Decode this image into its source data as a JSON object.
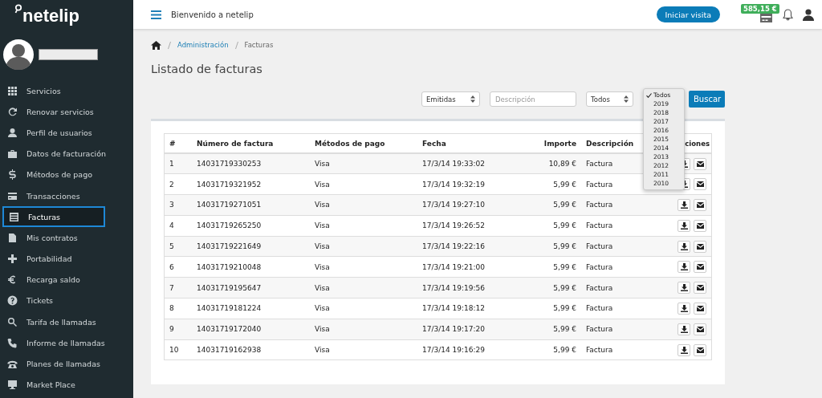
{
  "brand": "netelip",
  "sidebar": {
    "items": [
      {
        "label": "Servicios",
        "selected": false
      },
      {
        "label": "Renovar servicios",
        "selected": false
      },
      {
        "label": "Perfil de usuarios",
        "selected": false
      },
      {
        "label": "Datos de facturación",
        "selected": false
      },
      {
        "label": "Métodos de pago",
        "selected": false
      },
      {
        "label": "Transacciones",
        "selected": false
      },
      {
        "label": "Facturas",
        "selected": true
      },
      {
        "label": "Mis contratos",
        "selected": false
      },
      {
        "label": "Portabilidad",
        "selected": false
      },
      {
        "label": "Recarga saldo",
        "selected": false
      },
      {
        "label": "Tickets",
        "selected": false
      },
      {
        "label": "Tarifa de llamadas",
        "selected": false
      },
      {
        "label": "Informe de llamadas",
        "selected": false
      },
      {
        "label": "Planes de llamadas",
        "selected": false
      },
      {
        "label": "Market Place",
        "selected": false
      }
    ]
  },
  "topbar": {
    "title": "Bienvenido a netelip",
    "button": "Iniciar visita",
    "balance": "585,15 €"
  },
  "breadcrumb": [
    "Administración",
    "Facturas"
  ],
  "page_title": "Listado de facturas",
  "filters": {
    "type": "Emitidas",
    "description_placeholder": "Descripción",
    "year": "Todos",
    "button": "Buscar",
    "options": [
      {
        "label": "Todos",
        "selected": true
      },
      {
        "label": "2019",
        "selected": false
      },
      {
        "label": "2018",
        "selected": false
      },
      {
        "label": "2017",
        "selected": false
      },
      {
        "label": "2016",
        "selected": false
      },
      {
        "label": "2015",
        "selected": false
      },
      {
        "label": "2014",
        "selected": false
      },
      {
        "label": "2013",
        "selected": false
      },
      {
        "label": "2012",
        "selected": false
      },
      {
        "label": "2011",
        "selected": false
      },
      {
        "label": "2010",
        "selected": false
      }
    ]
  },
  "table": {
    "columns": [
      "#",
      "Número de factura",
      "Métodos de pago",
      "Fecha",
      "Importe",
      "Descripción",
      "ciones"
    ],
    "rows": [
      [
        "1",
        "14031719330253",
        "Visa",
        "17/3/14 19:33:02",
        "10,89 €",
        "Factura"
      ],
      [
        "2",
        "14031719321952",
        "Visa",
        "17/3/14 19:32:19",
        "5,99 €",
        "Factura"
      ],
      [
        "3",
        "14031719271051",
        "Visa",
        "17/3/14 19:27:10",
        "5,99 €",
        "Factura"
      ],
      [
        "4",
        "14031719265250",
        "Visa",
        "17/3/14 19:26:52",
        "5,99 €",
        "Factura"
      ],
      [
        "5",
        "14031719221649",
        "Visa",
        "17/3/14 19:22:16",
        "5,99 €",
        "Factura"
      ],
      [
        "6",
        "14031719210048",
        "Visa",
        "17/3/14 19:21:00",
        "5,99 €",
        "Factura"
      ],
      [
        "7",
        "14031719195647",
        "Visa",
        "17/3/14 19:19:56",
        "5,99 €",
        "Factura"
      ],
      [
        "8",
        "14031719181224",
        "Visa",
        "17/3/14 19:18:12",
        "5,99 €",
        "Factura"
      ],
      [
        "9",
        "14031719172040",
        "Visa",
        "17/3/14 19:17:20",
        "5,99 €",
        "Factura"
      ],
      [
        "10",
        "14031719162938",
        "Visa",
        "17/3/14 19:16:29",
        "5,99 €",
        "Factura"
      ]
    ]
  }
}
